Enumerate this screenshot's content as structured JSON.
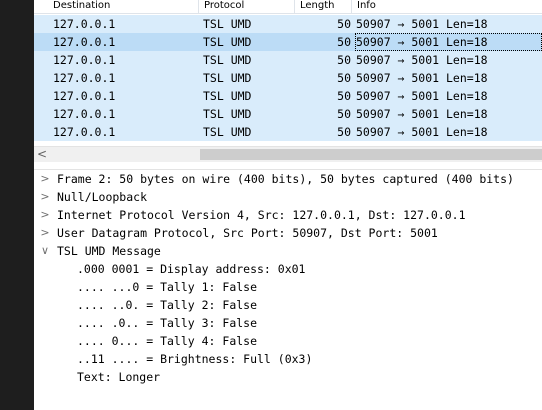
{
  "columns": {
    "destination": "Destination",
    "protocol": "Protocol",
    "length": "Length",
    "info": "Info"
  },
  "packets": [
    {
      "destination": "127.0.0.1",
      "protocol": "TSL UMD",
      "length": "50",
      "info": "50907 → 5001 Len=18"
    },
    {
      "destination": "127.0.0.1",
      "protocol": "TSL UMD",
      "length": "50",
      "info": "50907 → 5001 Len=18"
    },
    {
      "destination": "127.0.0.1",
      "protocol": "TSL UMD",
      "length": "50",
      "info": "50907 → 5001 Len=18"
    },
    {
      "destination": "127.0.0.1",
      "protocol": "TSL UMD",
      "length": "50",
      "info": "50907 → 5001 Len=18"
    },
    {
      "destination": "127.0.0.1",
      "protocol": "TSL UMD",
      "length": "50",
      "info": "50907 → 5001 Len=18"
    },
    {
      "destination": "127.0.0.1",
      "protocol": "TSL UMD",
      "length": "50",
      "info": "50907 → 5001 Len=18"
    },
    {
      "destination": "127.0.0.1",
      "protocol": "TSL UMD",
      "length": "50",
      "info": "50907 → 5001 Len=18"
    }
  ],
  "selected_packet_index": 1,
  "colors": {
    "row_background": "#d9ecfb",
    "selected_row_background": "#bcdcf6",
    "sidebar": "#1e1e1e"
  },
  "scrollbar": {
    "left_arrow": "<"
  },
  "details": {
    "collapsed_caret": ">",
    "expanded_caret": "∨",
    "frame": "Frame 2: 50 bytes on wire (400 bits), 50 bytes captured (400 bits)",
    "null_loopback": "Null/Loopback",
    "ip": "Internet Protocol Version 4, Src: 127.0.0.1, Dst: 127.0.0.1",
    "udp": "User Datagram Protocol, Src Port: 50907, Dst Port: 5001",
    "tsl": "TSL UMD Message",
    "tsl_fields": [
      ".000 0001 = Display address: 0x01",
      ".... ...0 = Tally 1: False",
      ".... ..0. = Tally 2: False",
      ".... .0.. = Tally 3: False",
      ".... 0... = Tally 4: False",
      "..11 .... = Brightness: Full (0x3)",
      "Text: Longer"
    ]
  }
}
